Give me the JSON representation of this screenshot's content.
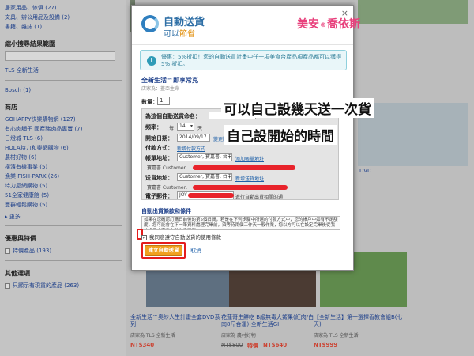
{
  "sidebar": {
    "links_top": [
      "居家用品、傢俱 (27)",
      "文具、辦公用品及設備 (2)",
      "書籍、雜誌 (1)"
    ],
    "narrow_heading": "縮小搜尋結果範圍",
    "store_link": "TLS 全新生活",
    "bosch_link": "Bosch (1)",
    "shops_heading": "商店",
    "shops": [
      "GOHAPPY快樂購物網 (127)",
      "有心肉舖子 國產豬肉品專賣 (7)",
      "日燈城 TLS (6)",
      "HOLA特力和樂網購物 (6)",
      "農村好物 (6)",
      "橫濱有機事業 (5)",
      "漁樂 FISH-PARK (26)",
      "特力屋網購物 (5)",
      "51全家健康館 (5)",
      "豐群輕鬆購物 (5)"
    ],
    "more_label": "更多",
    "promo_heading": "優惠與特價",
    "special_label": "特價產品 (193)",
    "other_heading": "其他選項",
    "other_label": "只顯示有現貨的產品 (263)"
  },
  "products": [
    {
      "title": "全新生活™奧紗人生計畫全套DVD系列",
      "seller": "店家為 TLS 全新生活",
      "price": "NT$340"
    },
    {
      "title": "花蓮哥生鮮吃 B級無毒大鱉果(紅肉/白肉8斤合運)-全新生活GI",
      "seller": "店家為 農村好物",
      "orig": "NT$800",
      "special_word": "特價",
      "special": "NT$640"
    },
    {
      "title": "【全新生活】第一選擇香教會組B(七天)",
      "seller": "店家為 TLS 全新生活",
      "price": "NT$999"
    }
  ],
  "bg_right_text": "DVD",
  "modal": {
    "logo_title": "自動送貨",
    "logo_sub_prefix": "可以",
    "logo_sub_save": "節省",
    "close": "×",
    "promo_text": "優惠：5%折扣！您的自動送貨計畫中任一項美食台產品項產品都可以獲得 5% 折扣。",
    "product_name": "全新生活™即享常克",
    "seller": "店家為：蓋亞生命",
    "qty_label": "數量：",
    "qty_value": "1",
    "form": {
      "name_label": "為這個自動送貨命名：",
      "freq_label": "頻率：",
      "freq_every": "每",
      "freq_num": "14",
      "freq_unit": "天",
      "start_label": "開始日期：",
      "start_value": "2014/09/17",
      "start_link": "變更開始日期",
      "pay_label": "付款方式：",
      "pay_link": "新增付款方式",
      "bill_label": "帳單地址：",
      "bill_value": "Customer, 寶嘉書, 台中市",
      "bill_link": "添加帳單地址",
      "bill_detail_prefix": "寶嘉書 Customer,",
      "ship_label": "送貨地址：",
      "ship_value": "Customer, 寶嘉書, 台中市",
      "ship_link": "新增送貨地址",
      "ship_detail_prefix": "寶嘉書 Customer,",
      "email_label": "電子郵件：",
      "email_value": "JOY",
      "email_suffix": "進行自動出貨相關的通"
    },
    "terms_title": "自動出貨條款和條件",
    "terms_text": "如果在您確認訂購日前後的第5個日間，若是在下列步驟中所選的付款方式中，您的帳戶中如有不足額度，您可能會在下一筆資料處理完畢前，須等待兩個工作天一般作業，您以方可以在設定完畢後從我的帳戶中查看自動送貨清單。",
    "agree_label": "我同意遵守自動送貨的使用條款",
    "agree_check": "✓",
    "submit": "建立自動送貨",
    "cancel": "取消"
  },
  "annotations": {
    "line1": "可以自己設幾天送一次貨",
    "line2": "自己設開始的時間"
  },
  "watermark": {
    "left": "美安",
    "mark": "®",
    "right": "喬依斯"
  }
}
